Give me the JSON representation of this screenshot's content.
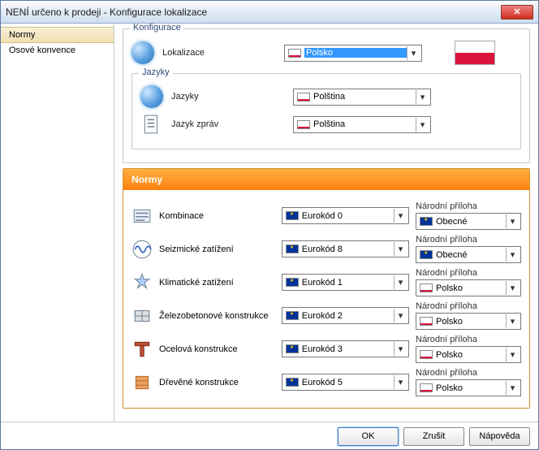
{
  "window": {
    "title": "NENÍ určeno k prodeji - Konfigurace lokalizace"
  },
  "sidebar": {
    "items": [
      {
        "label": "Normy",
        "active": true
      },
      {
        "label": "Osové konvence",
        "active": false
      }
    ]
  },
  "config": {
    "group_label": "Konfigurace",
    "localization_label": "Lokalizace",
    "localization_value": "Polsko",
    "languages_group_label": "Jazyky",
    "languages_label": "Jazyky",
    "languages_value": "Polština",
    "messages_label": "Jazyk zpráv",
    "messages_value": "Polština"
  },
  "norms": {
    "title": "Normy",
    "annex_label": "Národní příloha",
    "rows": [
      {
        "label": "Kombinace",
        "std": "Eurokód 0",
        "annex": "Obecné",
        "flag": "eu",
        "annex_flag": "eu"
      },
      {
        "label": "Seizmické zatížení",
        "std": "Eurokód 8",
        "annex": "Obecné",
        "flag": "eu",
        "annex_flag": "eu"
      },
      {
        "label": "Klimatické zatížení",
        "std": "Eurokód 1",
        "annex": "Polsko",
        "flag": "eu",
        "annex_flag": "pl"
      },
      {
        "label": "Železobetonové konstrukce",
        "std": "Eurokód 2",
        "annex": "Polsko",
        "flag": "eu",
        "annex_flag": "pl"
      },
      {
        "label": "Ocelová konstrukce",
        "std": "Eurokód 3",
        "annex": "Polsko",
        "flag": "eu",
        "annex_flag": "pl"
      },
      {
        "label": "Dřevěné konstrukce",
        "std": "Eurokód 5",
        "annex": "Polsko",
        "flag": "eu",
        "annex_flag": "pl"
      }
    ]
  },
  "buttons": {
    "ok": "OK",
    "cancel": "Zrušit",
    "help": "Nápověda"
  }
}
